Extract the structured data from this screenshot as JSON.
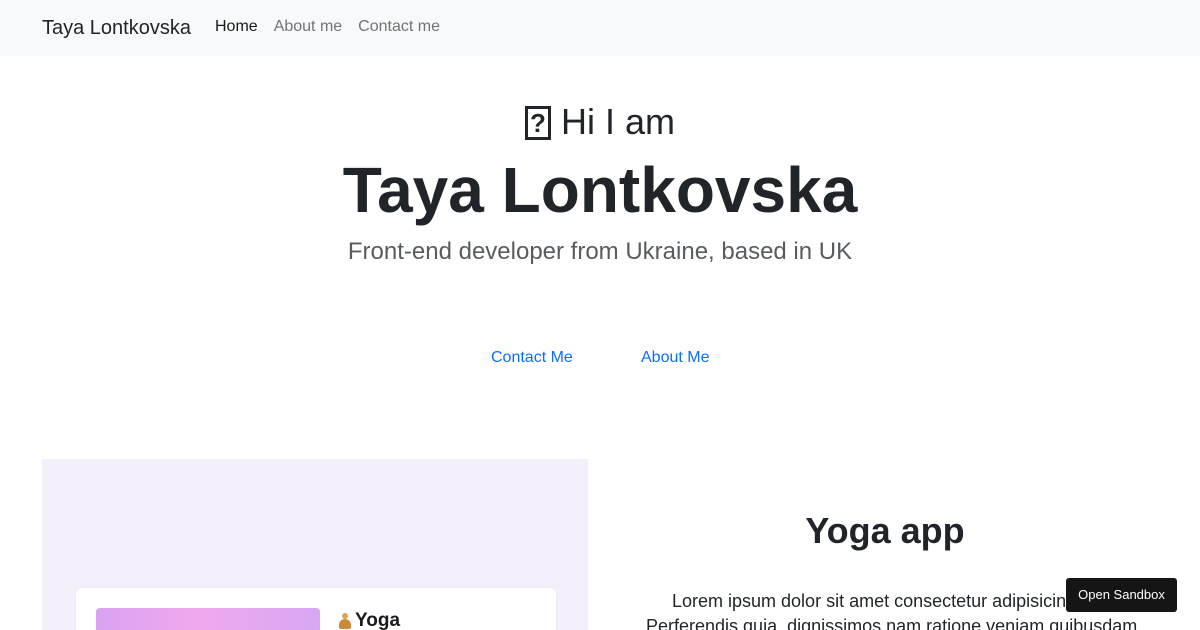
{
  "navbar": {
    "brand": "Taya Lontkovska",
    "links": [
      {
        "label": "Home",
        "active": true
      },
      {
        "label": "About me",
        "active": false
      },
      {
        "label": "Contact me",
        "active": false
      }
    ]
  },
  "hero": {
    "emoji": "hand-wave-emoji-missing-glyph",
    "greeting": "Hi I am",
    "name": "Taya Lontkovska",
    "tagline": "Front-end developer from Ukraine, based in UK",
    "buttons": {
      "contact": "Contact Me",
      "about": "About Me"
    }
  },
  "project": {
    "preview": {
      "app_title": "Yoga",
      "icon": "yoga-person-icon"
    },
    "title": "Yoga app",
    "description_line1": "Lorem ipsum dolor sit amet consectetur adipisicing",
    "description_line2": "Perferendis quia, dignissimos nam ratione veniam quibusdam"
  },
  "sandbox_button": "Open Sandbox",
  "colors": {
    "navbar_bg": "#f8f9fa",
    "link": "#0d6efd",
    "preview_bg": "#f3f0fc",
    "sandbox_bg": "#151515"
  }
}
